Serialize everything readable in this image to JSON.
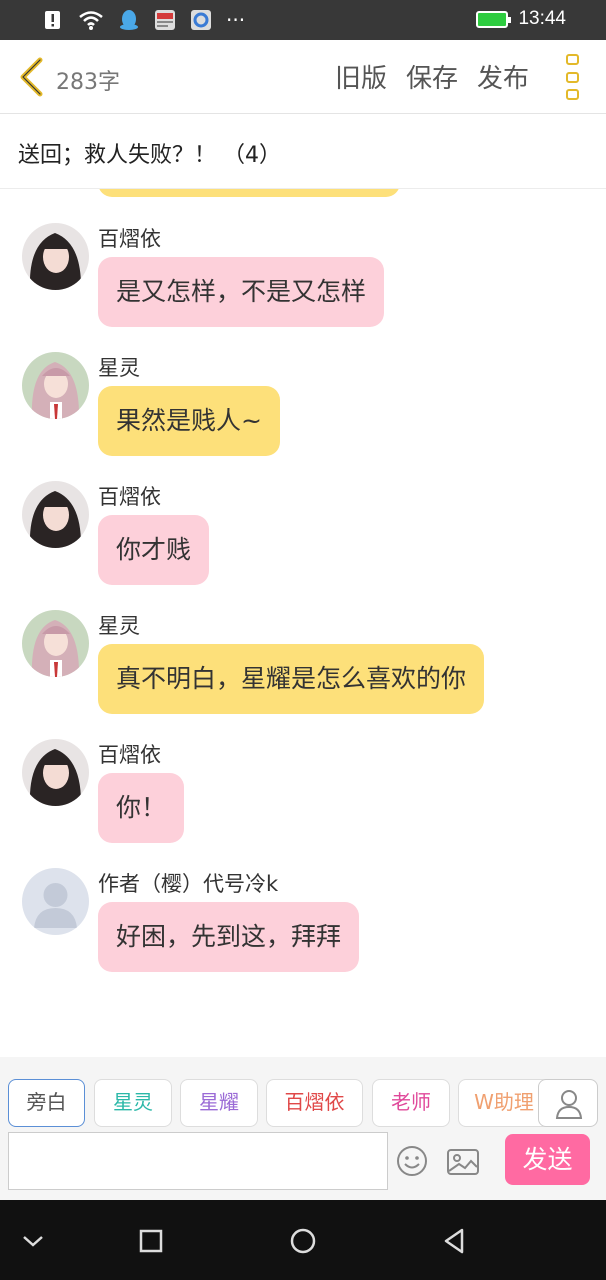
{
  "status_bar": {
    "time": "13:44",
    "icons": [
      "notification-icon",
      "wifi-icon",
      "qq-icon",
      "news-app-icon",
      "browser-app-icon",
      "more-icon",
      "battery-icon"
    ],
    "more": "···"
  },
  "header": {
    "word_count": "283字",
    "old_version": "旧版",
    "save": "保存",
    "publish": "发布"
  },
  "chapter": {
    "title": "送回；救人失败？！ （4）"
  },
  "messages": [
    {
      "sender": "百熠依",
      "text": "是又怎样，不是又怎样",
      "color": "pink"
    },
    {
      "sender": "星灵",
      "text": "果然是贱人~",
      "color": "yellow"
    },
    {
      "sender": "百熠依",
      "text": "你才贱",
      "color": "pink"
    },
    {
      "sender": "星灵",
      "text": "真不明白，星耀是怎么喜欢的你",
      "color": "yellow"
    },
    {
      "sender": "百熠依",
      "text": "你！",
      "color": "pink"
    },
    {
      "sender": "作者（樱）代号冷k",
      "text": "好困，先到这，拜拜",
      "color": "pink"
    }
  ],
  "roles": [
    {
      "label": "旁白",
      "color": "#555555"
    },
    {
      "label": "星灵",
      "color": "#2bb8a8"
    },
    {
      "label": "星耀",
      "color": "#9b6bd6"
    },
    {
      "label": "百熠依",
      "color": "#e04848"
    },
    {
      "label": "老师",
      "color": "#e0489a"
    },
    {
      "label": "W助理",
      "color": "#f0a070"
    }
  ],
  "composer": {
    "input_value": "",
    "send": "发送"
  },
  "colors": {
    "accent_yellow": "#e3b92a",
    "bubble_pink": "#fdd0da",
    "bubble_yellow": "#fde07a",
    "send_pink": "#ff6aa2"
  }
}
